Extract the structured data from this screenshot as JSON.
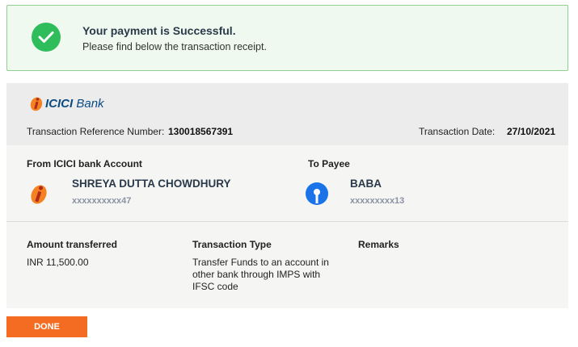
{
  "success": {
    "title": "Your payment is Successful.",
    "subtitle": "Please find below the transaction receipt."
  },
  "receipt": {
    "bank_logo": "ICICI",
    "bank_logo_suffix": "Bank",
    "ref_label": "Transaction Reference Number:",
    "ref_value": "130018567391",
    "date_label": "Transaction Date:",
    "date_value": "27/10/2021"
  },
  "from": {
    "label": "From ICICI bank Account",
    "name": "SHREYA DUTTA CHOWDHURY",
    "account": "xxxxxxxxxx47",
    "icon": "icici-logo-icon"
  },
  "to": {
    "label": "To Payee",
    "name": "BABA",
    "account": "xxxxxxxxx13",
    "icon": "sbi-logo-icon"
  },
  "details": {
    "amount_label": "Amount transferred",
    "amount_value": "INR 11,500.00",
    "type_label": "Transaction Type",
    "type_value": "Transfer Funds to an account in other bank through IMPS with IFSC code",
    "remarks_label": "Remarks",
    "remarks_value": ""
  },
  "actions": {
    "done_label": "DONE"
  },
  "colors": {
    "success_green": "#2ebd5a",
    "done_orange": "#f36c21",
    "icici_red": "#b02a1e",
    "icici_orange": "#f58220",
    "sbi_blue": "#1a73e8"
  }
}
